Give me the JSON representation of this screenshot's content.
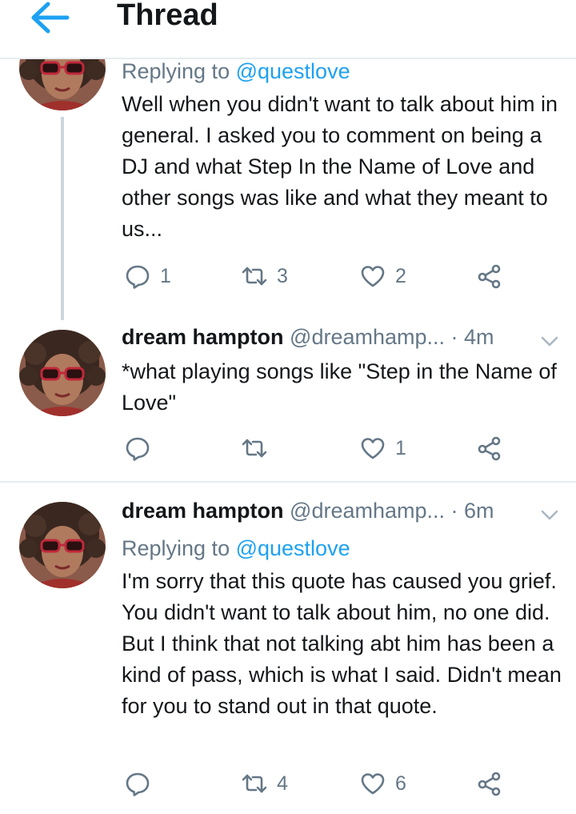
{
  "header": {
    "title": "Thread"
  },
  "tweets": [
    {
      "replying_prefix": "Replying to ",
      "replying_to": "@questlove",
      "text": "Well when you didn't want to talk about him in general. I asked you to comment on being a DJ and what Step In the Name of Love and other songs was like and what they meant to us...",
      "replies": "1",
      "retweets": "3",
      "likes": "2"
    },
    {
      "name": "dream hampton",
      "handle": "@dreamhamp...",
      "time": "· 4m",
      "text": "*what playing songs like \"Step in the Name of Love\"",
      "replies": "",
      "retweets": "",
      "likes": "1"
    },
    {
      "name": "dream hampton",
      "handle": "@dreamhamp...",
      "time": "· 6m",
      "replying_prefix": "Replying to ",
      "replying_to": "@questlove",
      "text": "I'm sorry that this quote has caused you grief. You didn't want to talk about him, no one did. But I think that not talking abt him has been a kind of pass, which is what I said. Didn't mean for you to stand out in that quote.",
      "replies": "",
      "retweets": "4",
      "likes": "6"
    }
  ],
  "colors": {
    "accent": "#1da1f2",
    "muted": "#657786",
    "text": "#14171a",
    "divider": "#e6ecf0"
  },
  "icons": [
    "back-arrow-icon",
    "reply-icon",
    "retweet-icon",
    "like-icon",
    "share-icon",
    "chevron-down-icon"
  ]
}
